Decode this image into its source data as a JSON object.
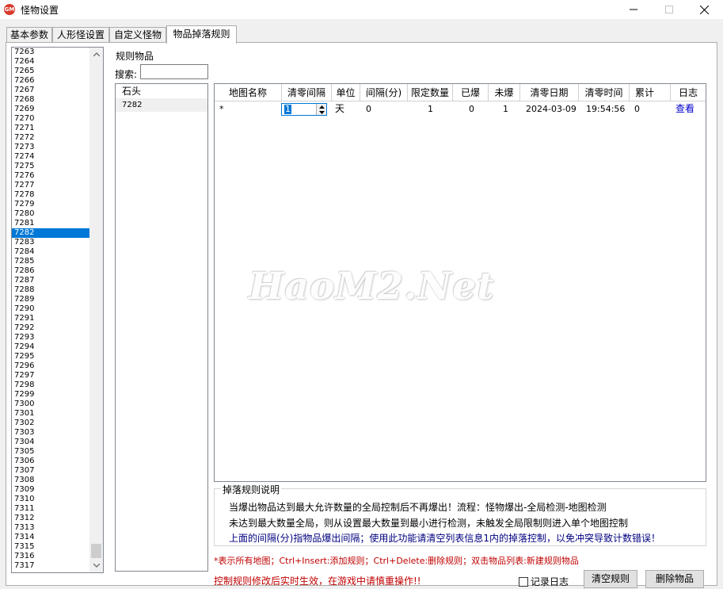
{
  "window": {
    "title": "怪物设置",
    "icon_text": "GM"
  },
  "tabs": [
    "基本参数",
    "人形怪设置",
    "自定义怪物",
    "物品掉落规则"
  ],
  "monster_list": {
    "items": [
      "7263",
      "7264",
      "7265",
      "7266",
      "7267",
      "7268",
      "7269",
      "7270",
      "7271",
      "7272",
      "7273",
      "7274",
      "7275",
      "7276",
      "7277",
      "7278",
      "7279",
      "7280",
      "7281",
      "7282",
      "7283",
      "7284",
      "7285",
      "7286",
      "7287",
      "7288",
      "7289",
      "7290",
      "7291",
      "7292",
      "7293",
      "7294",
      "7295",
      "7296",
      "7297",
      "7298",
      "7299",
      "7300",
      "7301",
      "7302",
      "7303",
      "7304",
      "7305",
      "7306",
      "7307",
      "7308",
      "7309",
      "7310",
      "7311",
      "7312",
      "7313",
      "7314",
      "7315",
      "7316",
      "7317"
    ],
    "selected": "7282"
  },
  "rule_items": {
    "group_title": "规则物品",
    "search_label": "搜索:",
    "search_value": "",
    "items": [
      "石头",
      "7282"
    ]
  },
  "grid": {
    "headers": [
      "地图名称",
      "清零间隔",
      "单位",
      "间隔(分)",
      "限定数量",
      "已爆",
      "未爆",
      "清零日期",
      "清零时间",
      "累计",
      "日志"
    ],
    "row": {
      "map": "*",
      "clear_interval": "1",
      "unit": "天",
      "interval_min": "0",
      "limit": "1",
      "dropped": "0",
      "not_dropped": "1",
      "clear_date": "2024-03-09",
      "clear_time": "19:54:56",
      "total": "0",
      "log": "查看"
    }
  },
  "rules_desc": {
    "title": "掉落规则说明",
    "line1": "当爆出物品达到最大允许数量的全局控制后不再爆出！流程：怪物爆出-全局检测-地图检测",
    "line2": "未达到最大数量全局，则从设置最大数量到最小进行检测，未触发全局限制则进入单个地图控制",
    "line3": "上面的间隔(分)指物品爆出间隔；使用此功能请清空列表信息1内的掉落控制，以免冲突导致计数错误！"
  },
  "hints": {
    "hint1": "*表示所有地图；Ctrl+Insert:添加规则；Ctrl+Delete:删除规则；双击物品列表:新建规则物品",
    "hint2": "控制规则修改后实时生效，在游戏中请慎重操作!!"
  },
  "controls": {
    "record_log": "记录日志",
    "clear_rules": "清空规则",
    "delete_item": "删除物品"
  },
  "watermark": "HaoM2.Net",
  "colors": {
    "selection": "#0078d7",
    "hint_red": "#c00000",
    "link_blue": "#0000cc",
    "note_navy": "#000080"
  }
}
